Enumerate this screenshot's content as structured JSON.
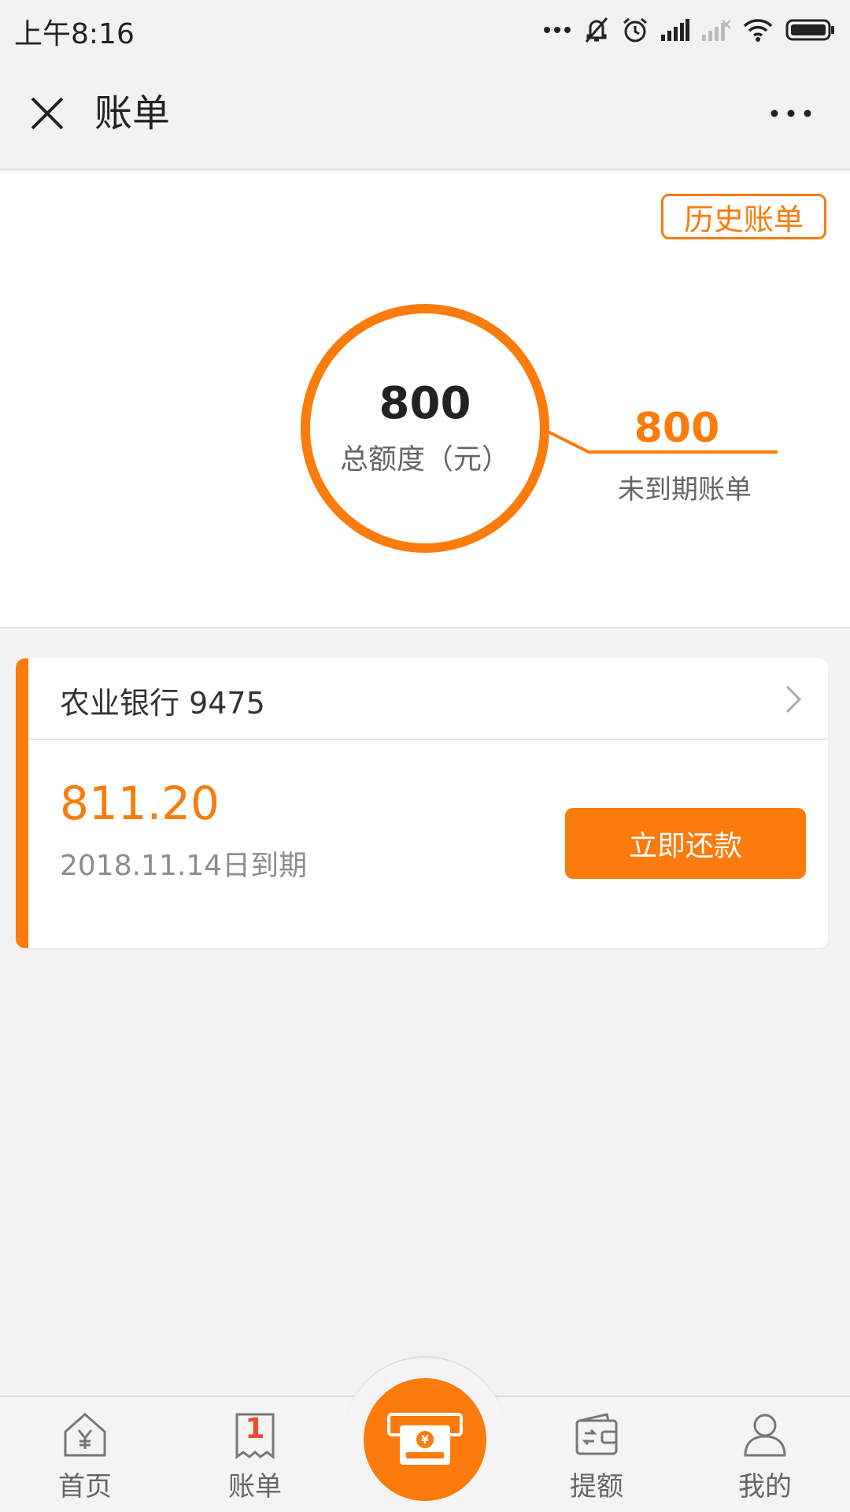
{
  "status_bar": {
    "time": "上午8:16",
    "icons": [
      "more-dots-icon",
      "mute-bell-icon",
      "alarm-icon",
      "signal-icon",
      "signal-off-icon",
      "wifi-icon",
      "battery-icon"
    ]
  },
  "nav": {
    "title": "账单",
    "close_icon": "close-icon",
    "more_icon": "more-icon"
  },
  "summary": {
    "history_label": "历史账单",
    "total_amount": "800",
    "total_label": "总额度（元）",
    "due_amount": "800",
    "due_label": "未到期账单"
  },
  "bill": {
    "bank": "农业银行 9475",
    "amount": "811.20",
    "due_date": "2018.11.14日到期",
    "pay_label": "立即还款"
  },
  "tabs": [
    {
      "label": "首页",
      "icon": "home-yen-icon"
    },
    {
      "label": "账单",
      "icon": "bill-icon",
      "badge": "1"
    },
    {
      "label": "",
      "icon": "cash-out-icon"
    },
    {
      "label": "提额",
      "icon": "wallet-icon"
    },
    {
      "label": "我的",
      "icon": "user-icon"
    }
  ],
  "colors": {
    "accent": "#fb7b0c",
    "background": "#f2f2f2"
  }
}
